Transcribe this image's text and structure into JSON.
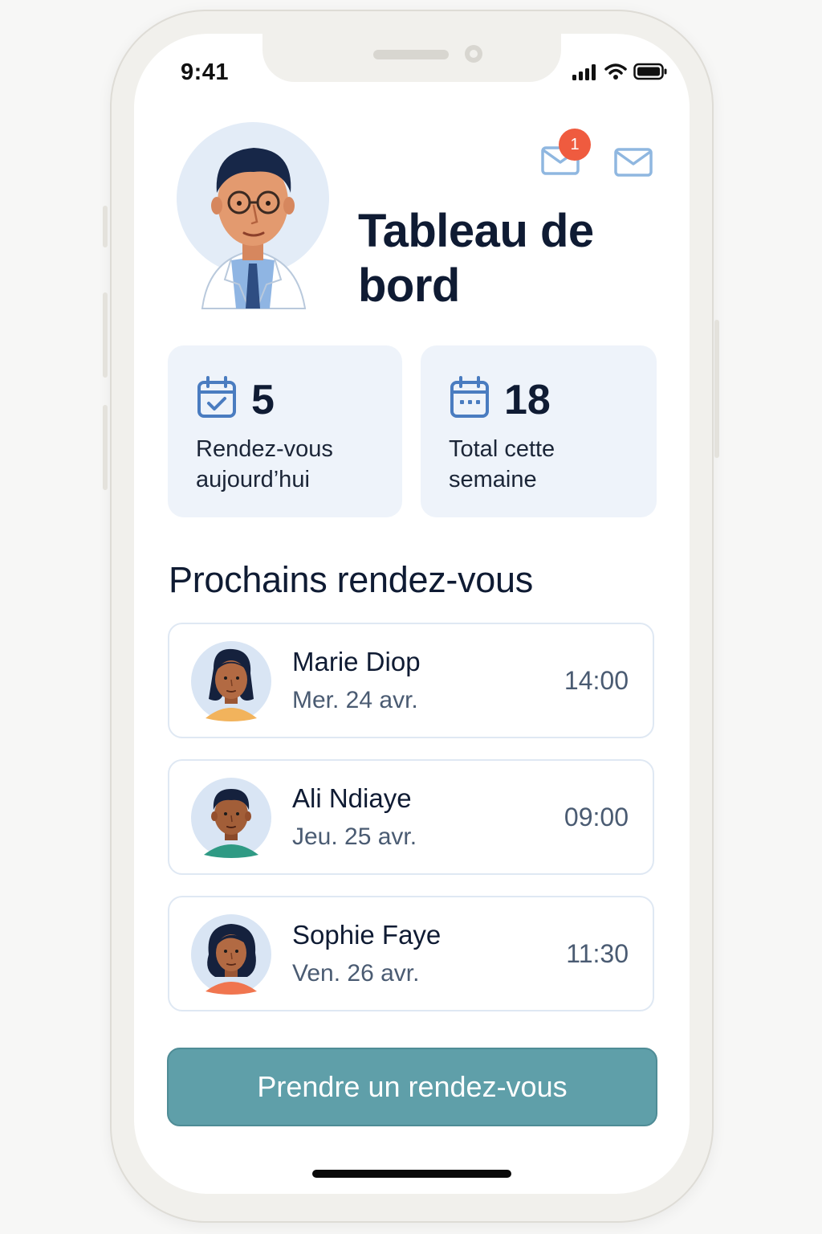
{
  "status_bar": {
    "time": "9:41"
  },
  "header": {
    "title": "Tableau de bord",
    "notification_count": "1",
    "icons": [
      "mail-notification-icon",
      "mail-icon"
    ]
  },
  "stats": [
    {
      "value": "5",
      "label": "Rendez-vous aujourd’hui",
      "icon": "calendar-check-icon"
    },
    {
      "value": "18",
      "label": "Total cette semaine",
      "icon": "calendar-icon"
    }
  ],
  "upcoming": {
    "title": "Prochains rendez-vous",
    "items": [
      {
        "name": "Marie Diop",
        "date": "Mer. 24 avr.",
        "time": "14:00"
      },
      {
        "name": "Ali Ndiaye",
        "date": "Jeu. 25 avr.",
        "time": "09:00"
      },
      {
        "name": "Sophie Faye",
        "date": "Ven. 26 avr.",
        "time": "11:30"
      }
    ]
  },
  "cta": {
    "label": "Prendre un rendez-vous"
  },
  "colors": {
    "primary": "#5f9fa9",
    "accent_icon": "#4a7cc0",
    "badge": "#ef5b3f",
    "card_bg": "#eef3fa",
    "title_text": "#0f1b33"
  }
}
